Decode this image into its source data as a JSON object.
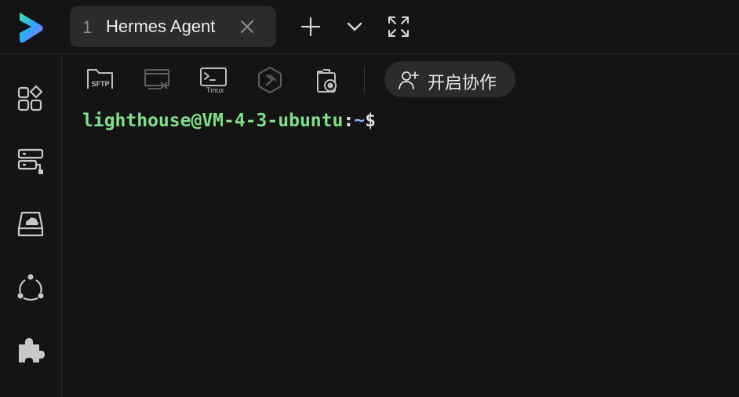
{
  "tabs": [
    {
      "index": "1",
      "title": "Hermes Agent",
      "active": true
    }
  ],
  "titlebar_actions": [
    "add-tab-icon",
    "chevron-down-icon",
    "fullscreen-icon"
  ],
  "toolbar": {
    "sftp_label": "SFTP",
    "tmux_label": "Tmux",
    "collab_label": "开启协作"
  },
  "sidebar": {
    "items": [
      "apps-grid-icon",
      "server-network-icon",
      "cloud-drive-icon",
      "share-nodes-icon",
      "puzzle-plugin-icon"
    ]
  },
  "terminal": {
    "prompt_user_host": "lighthouse@VM-4-3-ubuntu",
    "prompt_colon": ":",
    "prompt_path": "~",
    "prompt_symbol": "$"
  },
  "colors": {
    "background": "#141414",
    "tab_background": "#2b2b2b",
    "prompt_user": "#7fe08a",
    "prompt_path": "#8fb4ff",
    "icon_gray": "#bdbdbd",
    "icon_disabled": "#5e5e5e"
  }
}
